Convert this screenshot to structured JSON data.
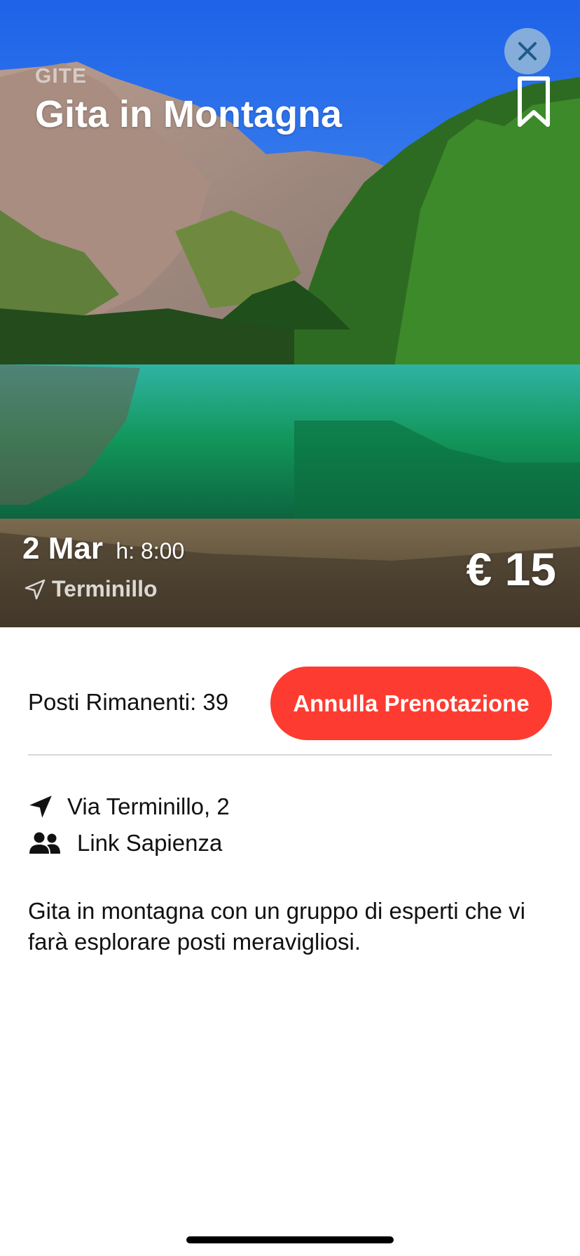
{
  "event": {
    "category": "GITE",
    "title": "Gita in Montagna",
    "date": "2 Mar",
    "time": "h: 8:00",
    "location": "Terminillo",
    "price": "€ 15"
  },
  "booking": {
    "seats_label": "Posti Rimanenti: 39",
    "cancel_label": "Annulla Prenotazione"
  },
  "details": {
    "address": "Via Terminillo, 2",
    "organizer": "Link Sapienza",
    "description": "Gita in montagna con un gruppo di esperti che vi farà esplorare posti meravigliosi."
  },
  "icons": {
    "close": "close-icon",
    "bookmark": "bookmark-icon",
    "location_outline": "location-arrow-outline-icon",
    "location_filled": "location-arrow-icon",
    "people": "people-icon"
  },
  "colors": {
    "accent_red": "#fe3b30",
    "close_button_bg": "#96b9d7",
    "close_icon": "#1f5a8a",
    "divider": "#d8d8d8"
  }
}
